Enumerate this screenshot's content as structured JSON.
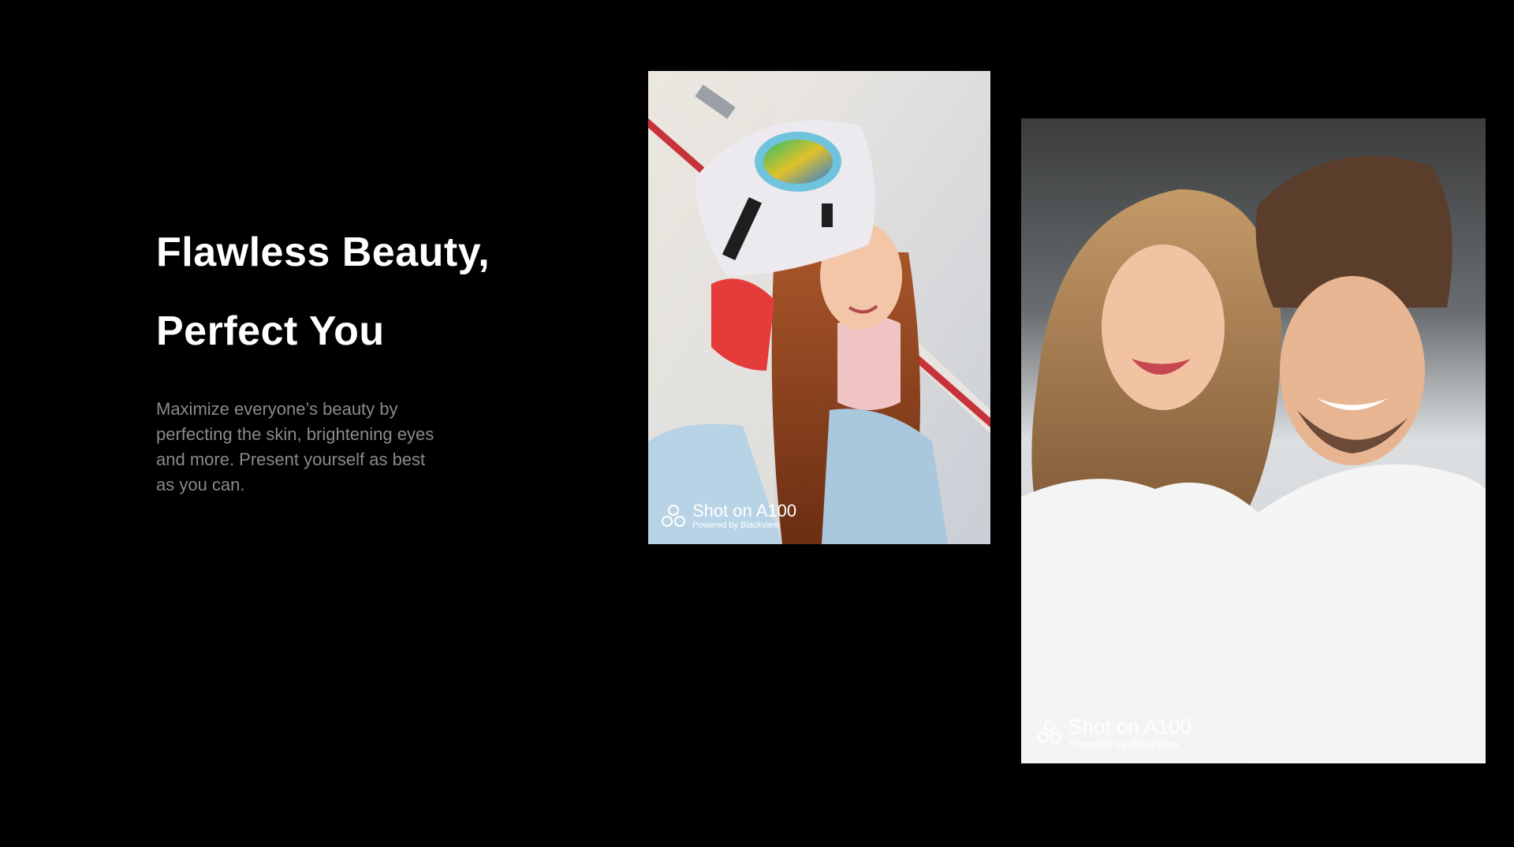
{
  "headline": {
    "line1": "Flawless Beauty,",
    "line2": "Perfect You"
  },
  "description": "Maximize everyone’s beauty by perfecting the skin, brightening eyes and more. Present yourself as best as you can.",
  "photos": [
    {
      "watermark_main": "Shot on A100",
      "watermark_sub": "Powered by Blackview"
    },
    {
      "watermark_main": "Shot on A100",
      "watermark_sub": "Powered by Blackview"
    }
  ],
  "colors": {
    "background": "#000000",
    "headline": "#ffffff",
    "body_text": "#8a8a8a"
  },
  "icons": {
    "watermark": "camera-aperture-icon"
  }
}
